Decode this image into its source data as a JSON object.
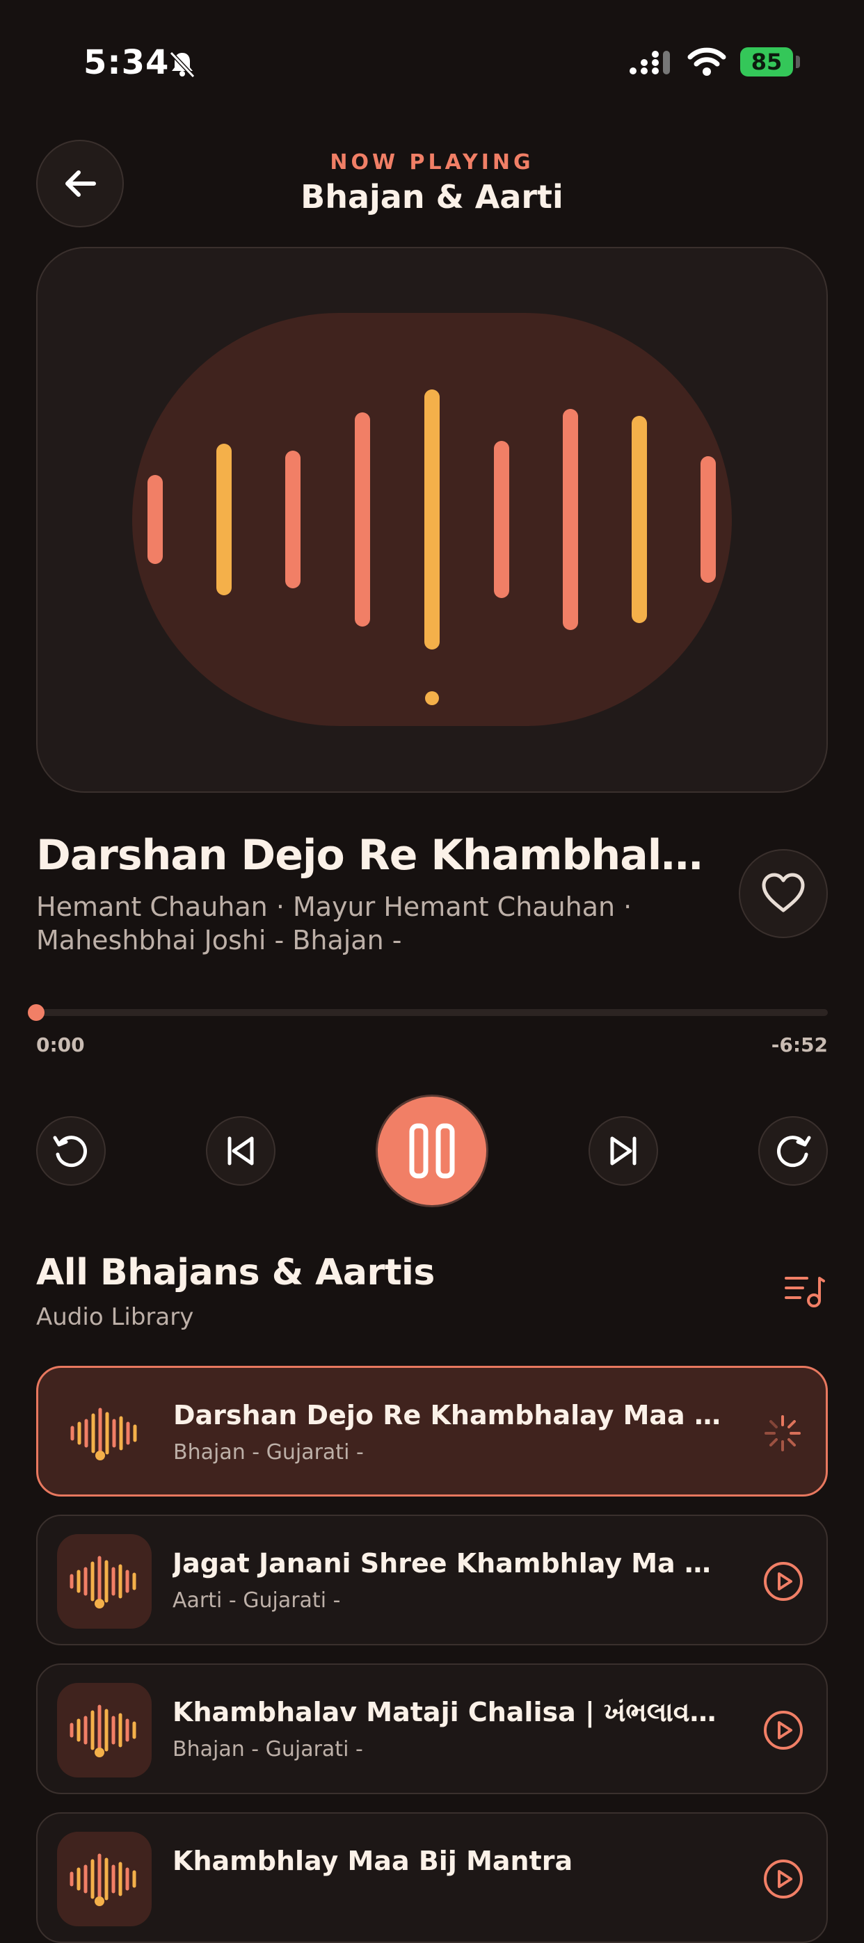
{
  "status_bar": {
    "time": "5:34",
    "battery": "85"
  },
  "header": {
    "eyebrow": "NOW PLAYING",
    "title": "Bhajan & Aarti"
  },
  "now_playing": {
    "title": "Darshan Dejo Re Khambhala...",
    "artists": "Hemant Chauhan · Mayur Hemant Chauhan · Maheshbhai Joshi - Bhajan -",
    "elapsed": "0:00",
    "remaining": "-6:52",
    "progress": 0
  },
  "library": {
    "title": "All Bhajans & Aartis",
    "subtitle": "Audio Library",
    "tracks": [
      {
        "title": "Darshan Dejo Re Khambhalay Maa Dar...",
        "subtitle": "Bhajan - Gujarati -",
        "state": "loading"
      },
      {
        "title": "Jagat Janani Shree Khambhlay Ma Ni...",
        "subtitle": "Aarti - Gujarati -",
        "state": "idle"
      },
      {
        "title": "Khambhalav Mataji Chalisa | ખંભલાવ મા...",
        "subtitle": "Bhajan - Gujarati -",
        "state": "idle"
      },
      {
        "title": "Khambhlay Maa Bij Mantra",
        "subtitle": "",
        "state": "idle"
      }
    ]
  },
  "colors": {
    "accent": "#f17f66",
    "gold": "#f4b04a",
    "background": "#161110"
  },
  "icons": {
    "back": "arrow-left-icon",
    "favorite": "heart-icon",
    "rewind": "rewind-icon",
    "previous": "skip-previous-icon",
    "pause": "pause-icon",
    "next": "skip-next-icon",
    "forward": "forward-icon",
    "queue": "playlist-music-icon",
    "loading": "spinner-icon",
    "play": "play-circle-icon"
  }
}
